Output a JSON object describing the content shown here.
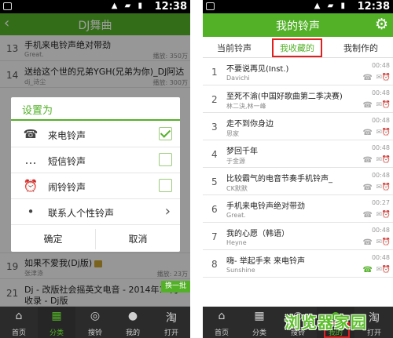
{
  "status_bar": {
    "time": "12:38",
    "icons": "▲ ▰ ▮"
  },
  "left_screen": {
    "title": "DJ舞曲",
    "back_icon": "‹",
    "songs": [
      {
        "num": "13",
        "name": "手机来电铃声绝对带劲",
        "singer": "Great.",
        "plays": "播放: 350万"
      },
      {
        "num": "14",
        "name": "送给这个世的兄弟YGH(兄弟为你)_DJ阿达",
        "singer": "dj_诗尘",
        "plays": "播放: 300万"
      },
      {
        "num": "19",
        "name": "如果不爱我(Dj版)",
        "singer": "张津涤",
        "plays": "播放: 23万"
      },
      {
        "num": "21",
        "name": "Dj - 改版社会摇英文电音 - 2014年10月",
        "name2": "收录 - Dj版",
        "singer": "",
        "plays": ""
      }
    ],
    "change_batch": "换一批",
    "dialog": {
      "title": "设置为",
      "options": [
        {
          "label": "来电铃声",
          "icon": "☎",
          "checked": true
        },
        {
          "label": "短信铃声",
          "icon": "…",
          "checked": false
        },
        {
          "label": "闹铃铃声",
          "icon": "⏰",
          "checked": false
        },
        {
          "label": "联系人个性铃声",
          "icon": "•",
          "checked": false
        }
      ],
      "ok": "确定",
      "cancel": "取消"
    },
    "tabs": [
      {
        "label": "首页",
        "icon": "⌂"
      },
      {
        "label": "分类",
        "icon": "▦"
      },
      {
        "label": "搜铃",
        "icon": "◎"
      },
      {
        "label": "我的",
        "icon": "●"
      },
      {
        "label": "打开",
        "icon": "淘"
      }
    ]
  },
  "right_screen": {
    "title": "我的铃声",
    "gear_icon": "⚙",
    "subtabs": [
      "当前铃声",
      "我收藏的",
      "我制作的"
    ],
    "songs": [
      {
        "num": "1",
        "name": "不要说再见(Inst.)",
        "singer": "Davichi",
        "duration": "00:48",
        "ringtone_on": false
      },
      {
        "num": "2",
        "name": "至死不渝(中国好歌曲第二季决赛)",
        "singer": "林二決,林一峰",
        "duration": "00:48",
        "ringtone_on": false
      },
      {
        "num": "3",
        "name": "走不到你身边",
        "singer": "思家",
        "duration": "00:48",
        "ringtone_on": false
      },
      {
        "num": "4",
        "name": "梦回千年",
        "singer": "于金源",
        "duration": "00:48",
        "ringtone_on": false
      },
      {
        "num": "5",
        "name": "比较霸气的电音节奏手机铃声_",
        "singer": "CK默默",
        "duration": "00:48",
        "ringtone_on": false
      },
      {
        "num": "6",
        "name": "手机来电铃声绝对带劲",
        "singer": "Great.",
        "duration": "00:27",
        "ringtone_on": false
      },
      {
        "num": "7",
        "name": "我的心愿（韩语）",
        "singer": "Heyne",
        "duration": "00:48",
        "ringtone_on": false
      },
      {
        "num": "8",
        "name": "嗨- 举起手来 来电铃声",
        "singer": "Sunshine",
        "duration": "00:48",
        "ringtone_on": true
      }
    ],
    "tabs": [
      {
        "label": "首页",
        "icon": "⌂"
      },
      {
        "label": "分类",
        "icon": "▦"
      },
      {
        "label": "搜铃",
        "icon": "◎"
      },
      {
        "label": "我的",
        "icon": "●"
      },
      {
        "label": "打开",
        "icon": "淘"
      }
    ],
    "row_icons": {
      "phone": "☎",
      "message": "✉",
      "clock": "⏰"
    }
  },
  "watermark": "浏览器家园",
  "colors": {
    "brand_green": "#53b128",
    "highlight_red": "#e02020",
    "tabbar_dark": "#2b2b2b"
  }
}
